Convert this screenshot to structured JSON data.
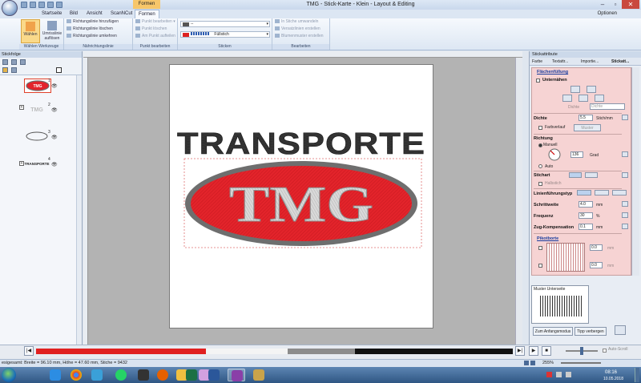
{
  "window": {
    "title": "TMG - Stick-Karte - Klein - Layout & Editing",
    "contextual_group": "Formen"
  },
  "tabs": [
    {
      "label": "Startseite"
    },
    {
      "label": "Bild"
    },
    {
      "label": "Ansicht"
    },
    {
      "label": "ScanNCut"
    },
    {
      "label": "Formen",
      "active": true
    }
  ],
  "options_label": "Optionen",
  "ribbon": {
    "waehlen": {
      "btn1": "Wählen",
      "btn2": "Umrisslinie auflösen",
      "label": "Wählen",
      "label2": "Werkzeuge"
    },
    "naehrichtung": {
      "items": [
        "Richtungslinie hinzufügen",
        "Richtungslinie löschen",
        "Richtungslinie umkehren"
      ],
      "label": "Nährichtungslinie"
    },
    "punkt": {
      "items": [
        "Punkt bearbeiten",
        "Punkt löschen",
        "Am Punkt aufteilen"
      ],
      "label": "Punkt bearbeiten"
    },
    "sticken": {
      "line_type": "--",
      "fill_type": "Füllstich",
      "label": "Sticken"
    },
    "bearbeiten": {
      "items": [
        "In Stiche umwandeln",
        "Versatzlinien erstellen",
        "Blumenmuster erstellen"
      ],
      "label": "Bearbeiten"
    }
  },
  "left_panel": {
    "title": "Stickfolge",
    "items": [
      {
        "num": "1"
      },
      {
        "num": "2"
      },
      {
        "num": "3"
      },
      {
        "num": "4"
      }
    ],
    "thumb_labels": [
      "TMG",
      "TMG",
      "",
      "TRANSPORTE"
    ]
  },
  "design": {
    "top_text": "TRANSPORTE",
    "oval_text": "TMG"
  },
  "right_panel": {
    "title": "Stickattribute",
    "tabs": [
      "Farbe",
      "Textattr...",
      "Importie...",
      "Stickatt..."
    ],
    "sections": {
      "flaechenfuellung": "Flächenfüllung",
      "unternaehen": "Unternähen",
      "dichte_sub": "Dichte",
      "dichte_sub_value": "Dichte",
      "dichte": "Dichte",
      "dichte_value": "5.5",
      "dichte_unit": "Stich/mm",
      "farbverlauf": "Farbverlauf",
      "muster": "Muster",
      "richtung": "Richtung",
      "manuell": "Manuell",
      "auto": "Auto",
      "richtung_value": "136",
      "richtung_unit": "Grad",
      "stichart": "Stichart",
      "halbstich": "Halbstich",
      "linienfuehrung": "Linienführungstyp",
      "schrittweite": "Schrittweite",
      "schrittweite_value": "4.0",
      "schrittweite_unit": "mm",
      "frequenz": "Frequenz",
      "frequenz_value": "30",
      "frequenz_unit": "%",
      "zugkomp": "Zug-Kompensation",
      "zugkomp_value": "0.1",
      "zugkomp_unit": "mm",
      "pikotborte": "Pikotborte",
      "pik1": "0.0",
      "pik2": "0.0",
      "pik_unit": "mm"
    },
    "preview_label": "Muster Unterseite",
    "btn_default": "Zum Anfangsmodus",
    "btn_tips": "Tipp verbergen"
  },
  "timeline": {
    "auto_scroll": "Auto-Scroll"
  },
  "status": {
    "text": "esigesamt: Breite = 96.10 mm, Höhe = 47.60 mm, Stiche = 9432",
    "zoom": "255%"
  },
  "taskbar": {
    "time": "08:16",
    "date": "10.05.2018",
    "apps": [
      "ie-icon",
      "chrome-icon",
      "network-icon",
      "whatsapp-icon",
      "camera-icon",
      "firefox-icon",
      "folder-icon",
      "excel-icon",
      "paint-icon",
      "word-icon",
      "app-icon",
      "explorer-icon"
    ]
  },
  "colors": {
    "oval_red": "#e3242b",
    "oval_border": "#6e6e6e",
    "text_dark": "#2c2c2c",
    "timeline_red": "#e02020"
  }
}
